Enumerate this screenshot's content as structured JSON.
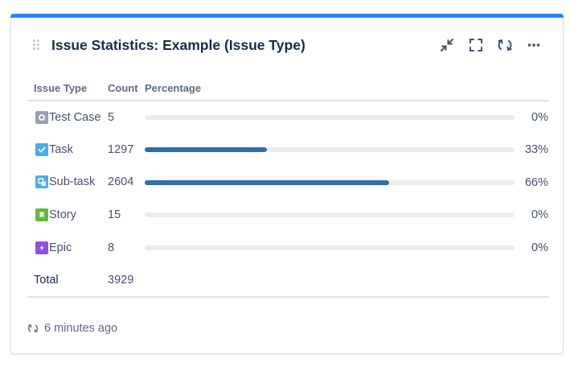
{
  "gadget": {
    "title": "Issue Statistics: Example (Issue Type)",
    "accent_color": "#2684ff",
    "actions": [
      {
        "name": "minimize-icon"
      },
      {
        "name": "fullscreen-icon"
      },
      {
        "name": "refresh-icon"
      },
      {
        "name": "more-icon"
      }
    ]
  },
  "table": {
    "headers": {
      "type": "Issue Type",
      "count": "Count",
      "percentage": "Percentage"
    },
    "rows": [
      {
        "type": "Test Case",
        "icon": "test-case-icon",
        "icon_color": "#97a0af",
        "count": "5",
        "percent_label": "0%",
        "fraction": 0.0
      },
      {
        "type": "Task",
        "icon": "task-icon",
        "icon_color": "#4bade8",
        "count": "1297",
        "percent_label": "33%",
        "fraction": 0.33
      },
      {
        "type": "Sub-task",
        "icon": "subtask-icon",
        "icon_color": "#4bade8",
        "count": "2604",
        "percent_label": "66%",
        "fraction": 0.66
      },
      {
        "type": "Story",
        "icon": "story-icon",
        "icon_color": "#63ba3c",
        "count": "15",
        "percent_label": "0%",
        "fraction": 0.0
      },
      {
        "type": "Epic",
        "icon": "epic-icon",
        "icon_color": "#904ee2",
        "count": "8",
        "percent_label": "0%",
        "fraction": 0.0
      }
    ],
    "total_label": "Total",
    "total_count": "3929",
    "bar_color": "#2d6fab"
  },
  "footer": {
    "updated": "6 minutes ago"
  }
}
